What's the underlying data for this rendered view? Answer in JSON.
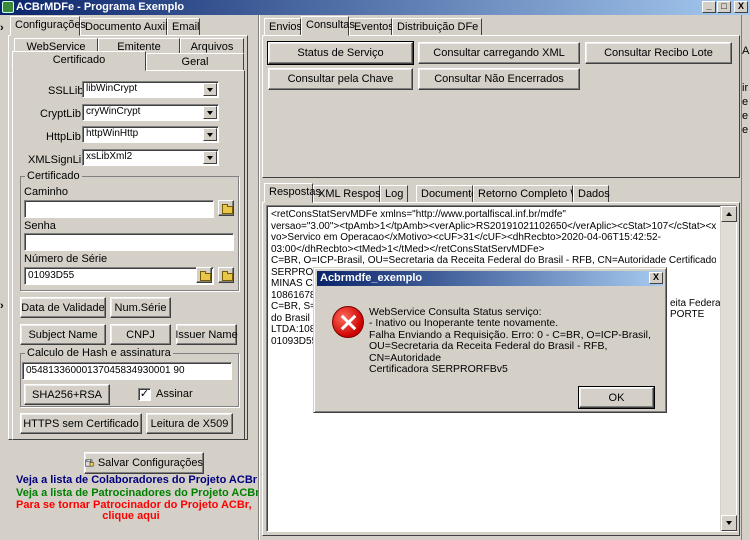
{
  "window": {
    "title": "ACBrMDFe - Programa Exemplo",
    "minimize": "_",
    "maximize": "□",
    "close": "X"
  },
  "left": {
    "tabs": [
      "Configurações",
      "Documento Auxiliar",
      "Email"
    ],
    "subtabs_row1": [
      "WebService",
      "Emitente",
      "Arquivos"
    ],
    "subtabs_row2": [
      "Certificado",
      "Geral"
    ],
    "libs": [
      {
        "label": "SSLLib",
        "value": "libWinCrypt"
      },
      {
        "label": "CryptLib",
        "value": "cryWinCrypt"
      },
      {
        "label": "HttpLib",
        "value": "httpWinHttp"
      },
      {
        "label": "XMLSignLib",
        "value": "xsLibXml2"
      }
    ],
    "certificado": {
      "group": "Certificado",
      "caminho_label": "Caminho",
      "caminho_value": "",
      "senha_label": "Senha",
      "senha_value": "",
      "numserie_label": "Número de Série",
      "numserie_value": "01093D55"
    },
    "buttons": {
      "data_validade": "Data de Validade",
      "num_serie": "Num.Série",
      "subject_name": "Subject Name",
      "cnpj": "CNPJ",
      "issuer_name": "Issuer Name"
    },
    "hash": {
      "group": "Calculo de Hash e assinatura",
      "value": "05481336000137045834930001 90",
      "sha_button": "SHA256+RSA",
      "assinar_label": "Assinar",
      "assinar_checked": "✓"
    },
    "https_button": "HTTPS sem Certificado",
    "x509_button": "Leitura de X509",
    "save_button": "Salvar Configurações",
    "links": {
      "colaboradores": "Veja a lista de Colaboradores do Projeto ACBr",
      "patrocinadores": "Veja a lista de Patrocinadores do Projeto ACBr",
      "tornar_1": "Para se tornar Patrocinador do Projeto ACBr,",
      "tornar_2": "clique aqui"
    },
    "colors": {
      "colaboradores": "#00007f",
      "patrocinadores": "#007f00",
      "tornar": "#ff0000"
    }
  },
  "right": {
    "tabs": [
      "Envios",
      "Consultas",
      "Eventos",
      "Distribuição DFe"
    ],
    "buttons": {
      "status": "Status de Serviço",
      "carregando_xml": "Consultar carregando XML",
      "recibo_lote": "Consultar Recibo Lote",
      "chave": "Consultar pela Chave",
      "nao_encerrados": "Consultar Não Encerrados"
    },
    "bottom_tabs": [
      "Respostas",
      "XML Resposta",
      "Log",
      "Documento",
      "Retorno Completo WS",
      "Dados"
    ],
    "memo_lines": [
      "<retConsStatServMDFe xmlns=\"http://www.portalfiscal.inf.br/mdfe\"",
      "versao=\"3.00\"><tpAmb>1</tpAmb><verAplic>RS20191021102650</verAplic><cStat>107</cStat><xMoti",
      "vo>Servico em Operacao</xMotivo><cUF>31</cUF><dhRecbto>2020-04-06T15:42:52-",
      "03:00</dhRecbto><tMed>1</tMed></retConsStatServMDFe>",
      "C=BR, O=ICP-Brasil, OU=Secretaria da Receita Federal do Brasil - RFB, CN=Autoridade Certificadora",
      "SERPRORFBv5",
      "MINAS CAL",
      "108616780",
      "C=BR, S=N",
      "do Brasil - F",
      "LTDA:1086",
      "01093D55"
    ],
    "memo_right_fragments": [
      "eita Federal",
      "PORTE"
    ]
  },
  "edge": {
    "right_letters": [
      "A",
      "ir",
      "e",
      "e",
      "e"
    ],
    "left_arrows": [
      "›",
      "›"
    ]
  },
  "dialog": {
    "title": "Acbrmdfe_exemplo",
    "close": "X",
    "message": [
      "WebService Consulta Status serviço:",
      "- Inativo ou Inoperante tente novamente.",
      "Falha Enviando a Requisição. Erro: 0 - C=BR, O=ICP-Brasil,",
      "OU=Secretaria da Receita Federal do Brasil - RFB, CN=Autoridade",
      "Certificadora SERPRORFBv5"
    ],
    "ok": "OK"
  }
}
